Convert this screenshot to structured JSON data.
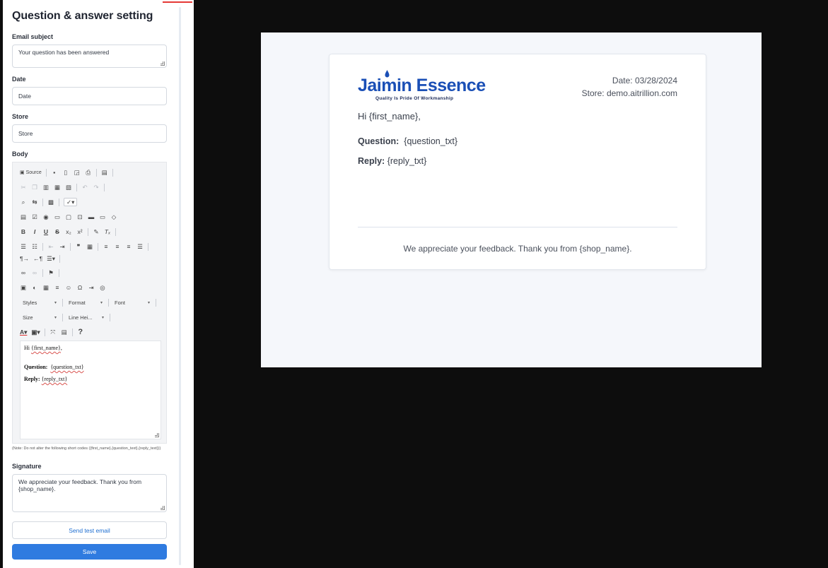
{
  "panel": {
    "title": "Question & answer setting",
    "email_subject_label": "Email subject",
    "email_subject_value": "Your question has been answered",
    "date_label": "Date",
    "date_value": "Date",
    "store_label": "Store",
    "store_value": "Store",
    "body_label": "Body",
    "editor": {
      "source_label": "Source",
      "styles_label": "Styles",
      "format_label": "Format",
      "font_label": "Font",
      "size_label": "Size",
      "line_height_label": "Line Hei...",
      "help_label": "?",
      "content": {
        "greeting_prefix": "Hi ",
        "greeting_token": "{first_name}",
        "greeting_suffix": ",",
        "question_label": "Question:",
        "question_token": "{question_txt}",
        "reply_label": "Reply:",
        "reply_token": "{reply_txt}"
      }
    },
    "note": "(Note: Do not alter the following short codes ({first_name},{question_text},{reply_text}))",
    "signature_label": "Signature",
    "signature_value": "We appreciate your feedback. Thank you from {shop_name}.",
    "send_test_label": "Send test email",
    "save_label": "Save"
  },
  "preview": {
    "logo_text": "Jaimin Essence",
    "logo_tagline": "Quality Is Pride Of Workmanship",
    "date_line": "Date: 03/28/2024",
    "store_line": "Store: demo.aitrillion.com",
    "greeting": "Hi {first_name},",
    "question_label": "Question:",
    "question_value": "{question_txt}",
    "reply_label": "Reply:",
    "reply_value": "{reply_txt}",
    "signature": "We appreciate your feedback. Thank you from {shop_name}."
  },
  "colors": {
    "brand_blue": "#1a4fb6",
    "primary_button": "#2f7be0",
    "link_blue": "#1f6fd1",
    "background": "#0d0d0d",
    "preview_bg": "#f5f7fb"
  },
  "icons": [
    "source-icon",
    "save-icon",
    "new-page-icon",
    "preview-icon",
    "print-icon",
    "templates-icon",
    "cut-icon",
    "copy-icon",
    "paste-icon",
    "paste-text-icon",
    "paste-word-icon",
    "undo-icon",
    "redo-icon",
    "find-icon",
    "replace-icon",
    "select-all-icon",
    "spellcheck-icon",
    "form-icon",
    "checkbox-icon",
    "radio-icon",
    "textfield-icon",
    "textarea-icon",
    "select-icon",
    "button-icon",
    "imagebutton-icon",
    "hiddenfield-icon",
    "bold-icon",
    "italic-icon",
    "underline-icon",
    "strike-icon",
    "subscript-icon",
    "superscript-icon",
    "copy-format-icon",
    "remove-format-icon",
    "numbered-list-icon",
    "bulleted-list-icon",
    "outdent-icon",
    "indent-icon",
    "blockquote-icon",
    "div-icon",
    "align-left-icon",
    "align-center-icon",
    "align-right-icon",
    "justify-icon",
    "ltr-icon",
    "rtl-icon",
    "language-icon",
    "link-icon",
    "unlink-icon",
    "anchor-icon",
    "image-icon",
    "flash-icon",
    "table-icon",
    "hline-icon",
    "smiley-icon",
    "special-char-icon",
    "pagebreak-icon",
    "iframe-icon",
    "text-color-icon",
    "bg-color-icon",
    "maximize-icon",
    "show-blocks-icon",
    "help-icon"
  ]
}
